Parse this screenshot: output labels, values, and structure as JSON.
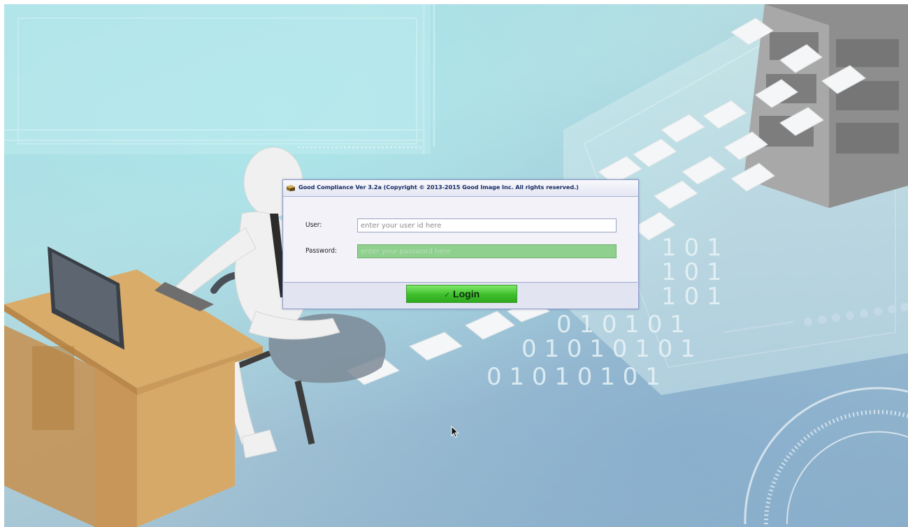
{
  "window": {
    "title": "Good Compliance Ver 3.2a (Copyright © 2013-2015 Good Image Inc. All rights reserved.)"
  },
  "form": {
    "user_label": "User:",
    "user_placeholder": "enter your user id here",
    "user_value": "",
    "password_label": "Password:",
    "password_placeholder": "enter your password here",
    "password_value": ""
  },
  "actions": {
    "login_label": "Login"
  },
  "background": {
    "binary_rows": [
      "1 0 1",
      "1 0 1",
      "1 0 1",
      "0 1 0 1 0 1",
      "0 1 0 1 0 1 0 1",
      "0 1 0 1 0 1 0 1"
    ]
  },
  "icons": {
    "app": "app-icon",
    "login": "check-icon",
    "cursor": "mouse-cursor-icon"
  },
  "colors": {
    "password_field": "#8fd08f",
    "login_button": "#3fbf2c",
    "title_text": "#1a2e66"
  }
}
